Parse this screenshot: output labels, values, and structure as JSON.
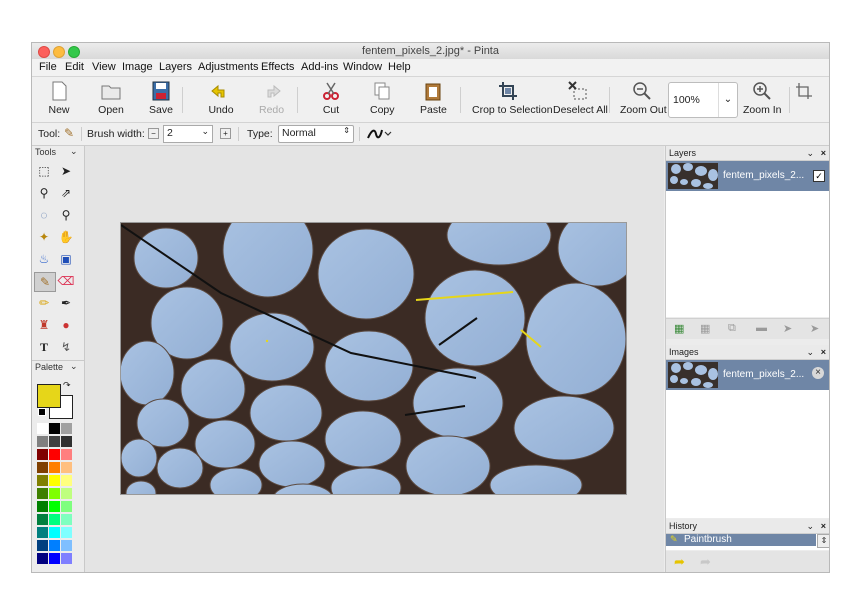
{
  "window": {
    "title": "fentem_pixels_2.jpg* - Pinta"
  },
  "menu": [
    "File",
    "Edit",
    "View",
    "Image",
    "Layers",
    "Adjustments",
    "Effects",
    "Add-ins",
    "Window",
    "Help"
  ],
  "toolbar": {
    "new": "New",
    "open": "Open",
    "save": "Save",
    "undo": "Undo",
    "redo": "Redo",
    "cut": "Cut",
    "copy": "Copy",
    "paste": "Paste",
    "crop": "Crop to Selection",
    "deselect": "Deselect All",
    "zoom_out": "Zoom Out",
    "zoom_value": "100%",
    "zoom_in": "Zoom In"
  },
  "tool_options": {
    "tool_label": "Tool:",
    "brush_width_label": "Brush width:",
    "brush_width_value": "2",
    "type_label": "Type:",
    "type_value": "Normal"
  },
  "panels": {
    "tools": "Tools",
    "palette": "Palette",
    "layers": "Layers",
    "images": "Images",
    "history": "History"
  },
  "layers": {
    "name": "fentem_pixels_2..."
  },
  "images": {
    "name": "fentem_pixels_2..."
  },
  "history": {
    "item": "Paintbrush"
  },
  "colors": {
    "primary": "#e6d619",
    "secondary": "#ffffff",
    "selection": "#6f86a6",
    "palette": [
      "#ffffff",
      "#000000",
      "#a0a0a0",
      "#808080",
      "#404040",
      "#303030",
      "#7f0000",
      "#ff0000",
      "#ff7f7f",
      "#7f3f00",
      "#ff7f00",
      "#ffbf7f",
      "#7f7f00",
      "#ffff00",
      "#ffff7f",
      "#3f7f00",
      "#7fff00",
      "#bfff7f",
      "#007f00",
      "#00ff00",
      "#7fff7f",
      "#007f3f",
      "#00ff7f",
      "#7fffbf",
      "#007f7f",
      "#00ffff",
      "#7fffff",
      "#003f7f",
      "#007fff",
      "#7fbfff",
      "#00007f",
      "#0000ff",
      "#7f7fff"
    ]
  }
}
